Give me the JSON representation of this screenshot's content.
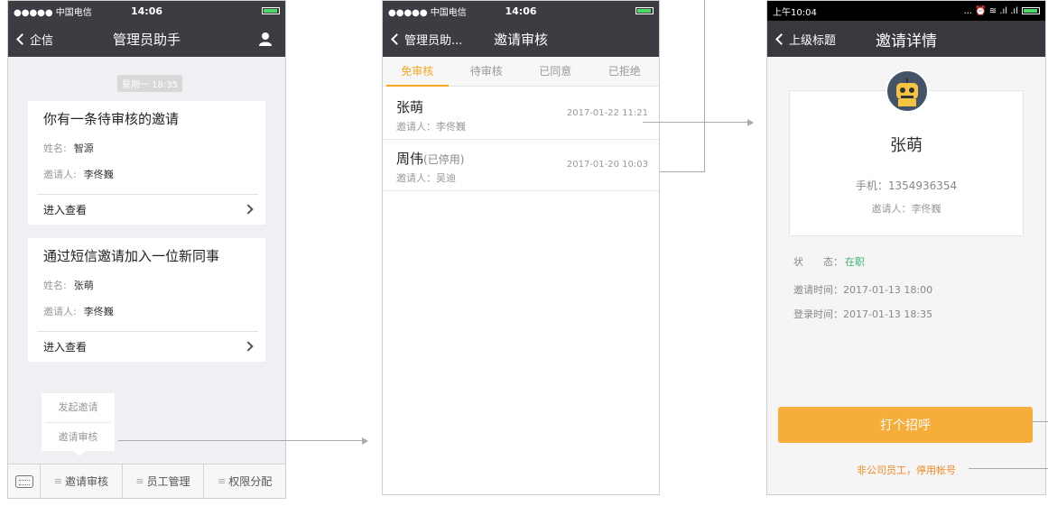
{
  "screen1": {
    "status": {
      "left": "●●●●● 中国电信 ",
      "time": "14:06"
    },
    "nav": {
      "back": "企信",
      "title": "管理员助手"
    },
    "time_chip": "星期一 18:35",
    "card1": {
      "title": "你有一条待审核的邀请",
      "name_label": "姓名:",
      "name_value": "智源",
      "inviter_label": "邀请人:",
      "inviter_value": "李佟巍",
      "link": "进入查看"
    },
    "card2": {
      "title": "通过短信邀请加入一位新同事",
      "name_label": "姓名:",
      "name_value": "张萌",
      "inviter_label": "邀请人:",
      "inviter_value": "李佟巍",
      "link": "进入查看"
    },
    "popup": [
      "发起邀请",
      "邀请审核"
    ],
    "tabbar": [
      "邀请审核",
      "员工管理",
      "权限分配"
    ]
  },
  "screen2": {
    "status": {
      "left": "●●●●● 中国电信 ",
      "time": "14:06"
    },
    "nav": {
      "back": "管理员助...",
      "title": "邀请审核"
    },
    "tabs": [
      "免审核",
      "待审核",
      "已同意",
      "已拒绝"
    ],
    "active_tab": "免审核",
    "items": [
      {
        "name": "张萌",
        "note": "",
        "inviter": "邀请人：李佟巍",
        "date": "2017-01-22  11:21"
      },
      {
        "name": "周伟",
        "note": "(已停用)",
        "inviter": "邀请人：吴迪",
        "date": "2017-01-20  10:03"
      }
    ]
  },
  "screen3": {
    "status": {
      "time": "上午10:04",
      "right": "... ⏰ ≋ .ıl .ıl"
    },
    "nav": {
      "back": "上级标题",
      "title": "邀请详情"
    },
    "name": "张萌",
    "phone": "手机：1354936354",
    "inviter": "邀请人：李佟巍",
    "status_label": "状　　态：",
    "status_value": "在职",
    "invite_time": "邀请时间：2017-01-13 18:00",
    "login_time": "登录时间：2017-01-13 18:35",
    "button": "打个招呼",
    "disable_link": "非公司员工，停用帐号"
  },
  "colors": {
    "accent": "#f5a623",
    "button": "#f7ad3a",
    "nav": "#3c3c42",
    "status_ok": "#3cb371"
  }
}
